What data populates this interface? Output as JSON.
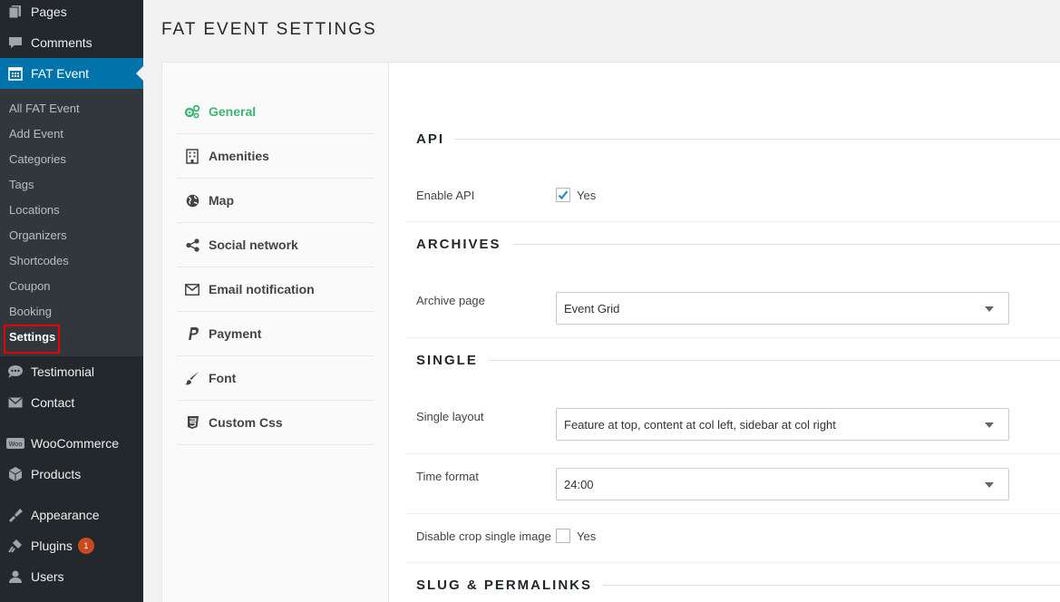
{
  "sidebar": {
    "top_items": [
      {
        "label": "Pages",
        "icon": "pages-icon"
      },
      {
        "label": "Comments",
        "icon": "comments-icon"
      },
      {
        "label": "FAT Event",
        "icon": "calendar-icon"
      }
    ],
    "submenu": [
      "All FAT Event",
      "Add Event",
      "Categories",
      "Tags",
      "Locations",
      "Organizers",
      "Shortcodes",
      "Coupon",
      "Booking",
      "Settings"
    ],
    "bottom_items": [
      {
        "label": "Testimonial",
        "icon": "testimonial-icon"
      },
      {
        "label": "Contact",
        "icon": "mail-icon"
      },
      {
        "label": "WooCommerce",
        "icon": "woocommerce-icon"
      },
      {
        "label": "Products",
        "icon": "products-icon"
      },
      {
        "label": "Appearance",
        "icon": "appearance-icon"
      },
      {
        "label": "Plugins",
        "icon": "plugins-icon",
        "badge": "1"
      },
      {
        "label": "Users",
        "icon": "users-icon"
      }
    ],
    "accent": "#0073aa",
    "bg": "#23282d"
  },
  "page": {
    "title": "FAT EVENT SETTINGS"
  },
  "tabs": [
    {
      "label": "General",
      "icon": "gears-icon",
      "active": true
    },
    {
      "label": "Amenities",
      "icon": "building-icon"
    },
    {
      "label": "Map",
      "icon": "globe-icon"
    },
    {
      "label": "Social network",
      "icon": "share-icon"
    },
    {
      "label": "Email notification",
      "icon": "envelope-icon"
    },
    {
      "label": "Payment",
      "icon": "paypal-icon"
    },
    {
      "label": "Font",
      "icon": "brush-icon"
    },
    {
      "label": "Custom Css",
      "icon": "css3-icon"
    }
  ],
  "sections": {
    "api": {
      "title": "API",
      "enable_api_label": "Enable API",
      "enable_api_option": "Yes",
      "enable_api_checked": true
    },
    "archives": {
      "title": "ARCHIVES",
      "archive_page_label": "Archive page",
      "archive_page_value": "Event Grid"
    },
    "single": {
      "title": "SINGLE",
      "single_layout_label": "Single layout",
      "single_layout_value": "Feature at top, content at col left, sidebar at col right",
      "time_format_label": "Time format",
      "time_format_value": "24:00",
      "disable_crop_label": "Disable crop single image",
      "disable_crop_option": "Yes",
      "disable_crop_checked": false
    },
    "slug": {
      "title": "SLUG & PERMALINKS"
    }
  },
  "colors": {
    "active_tab": "#3fb575",
    "checkbox_tick": "#1e8cbe"
  }
}
